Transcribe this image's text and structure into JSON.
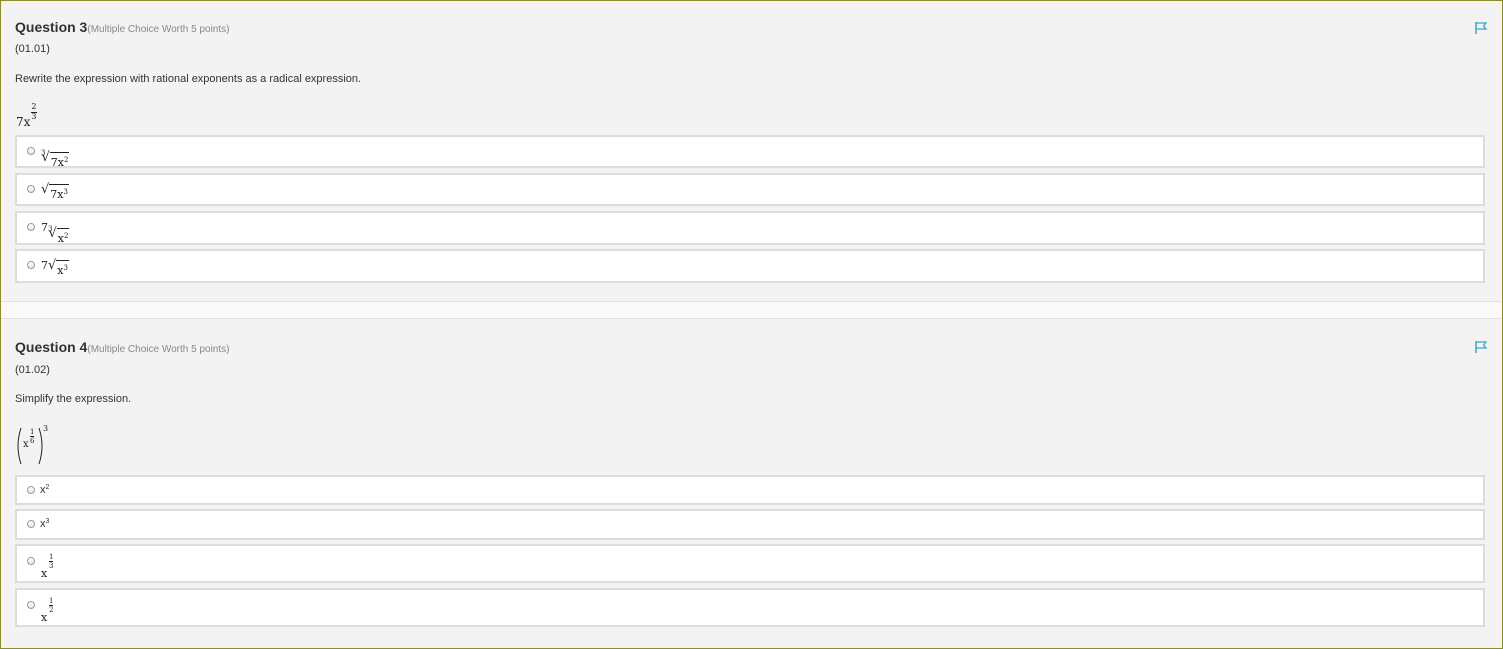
{
  "questions": [
    {
      "title": "Question 3",
      "worth": "(Multiple Choice Worth 5 points)",
      "code": "(01.01)",
      "prompt": "Rewrite the expression with rational exponents as a radical expression.",
      "expression": {
        "base": "7x",
        "exp_num": "2",
        "exp_den": "3"
      },
      "options": [
        {
          "index": "3",
          "radicand": "7x",
          "power": "2",
          "coef": ""
        },
        {
          "index": "",
          "radicand": "7x",
          "power": "3",
          "coef": ""
        },
        {
          "index": "3",
          "radicand": "x",
          "power": "2",
          "coef": "7"
        },
        {
          "index": "",
          "radicand": "x",
          "power": "3",
          "coef": "7"
        }
      ]
    },
    {
      "title": "Question 4",
      "worth": "(Multiple Choice Worth 5 points)",
      "code": "(01.02)",
      "prompt": "Simplify the expression.",
      "expression": {
        "base": "x",
        "inner_num": "1",
        "inner_den": "6",
        "outer_exp": "3"
      },
      "options": [
        {
          "base": "x",
          "power": "2"
        },
        {
          "base": "x",
          "power": "3"
        },
        {
          "base": "x",
          "num": "1",
          "den": "3"
        },
        {
          "base": "x",
          "num": "1",
          "den": "2"
        }
      ]
    }
  ],
  "colors": {
    "flag": "#3aa7c9",
    "background": "#f3f3f3",
    "option_border": "#dcdcdc"
  },
  "icons": {
    "flag": "flag-icon",
    "radio": "radio-button"
  }
}
